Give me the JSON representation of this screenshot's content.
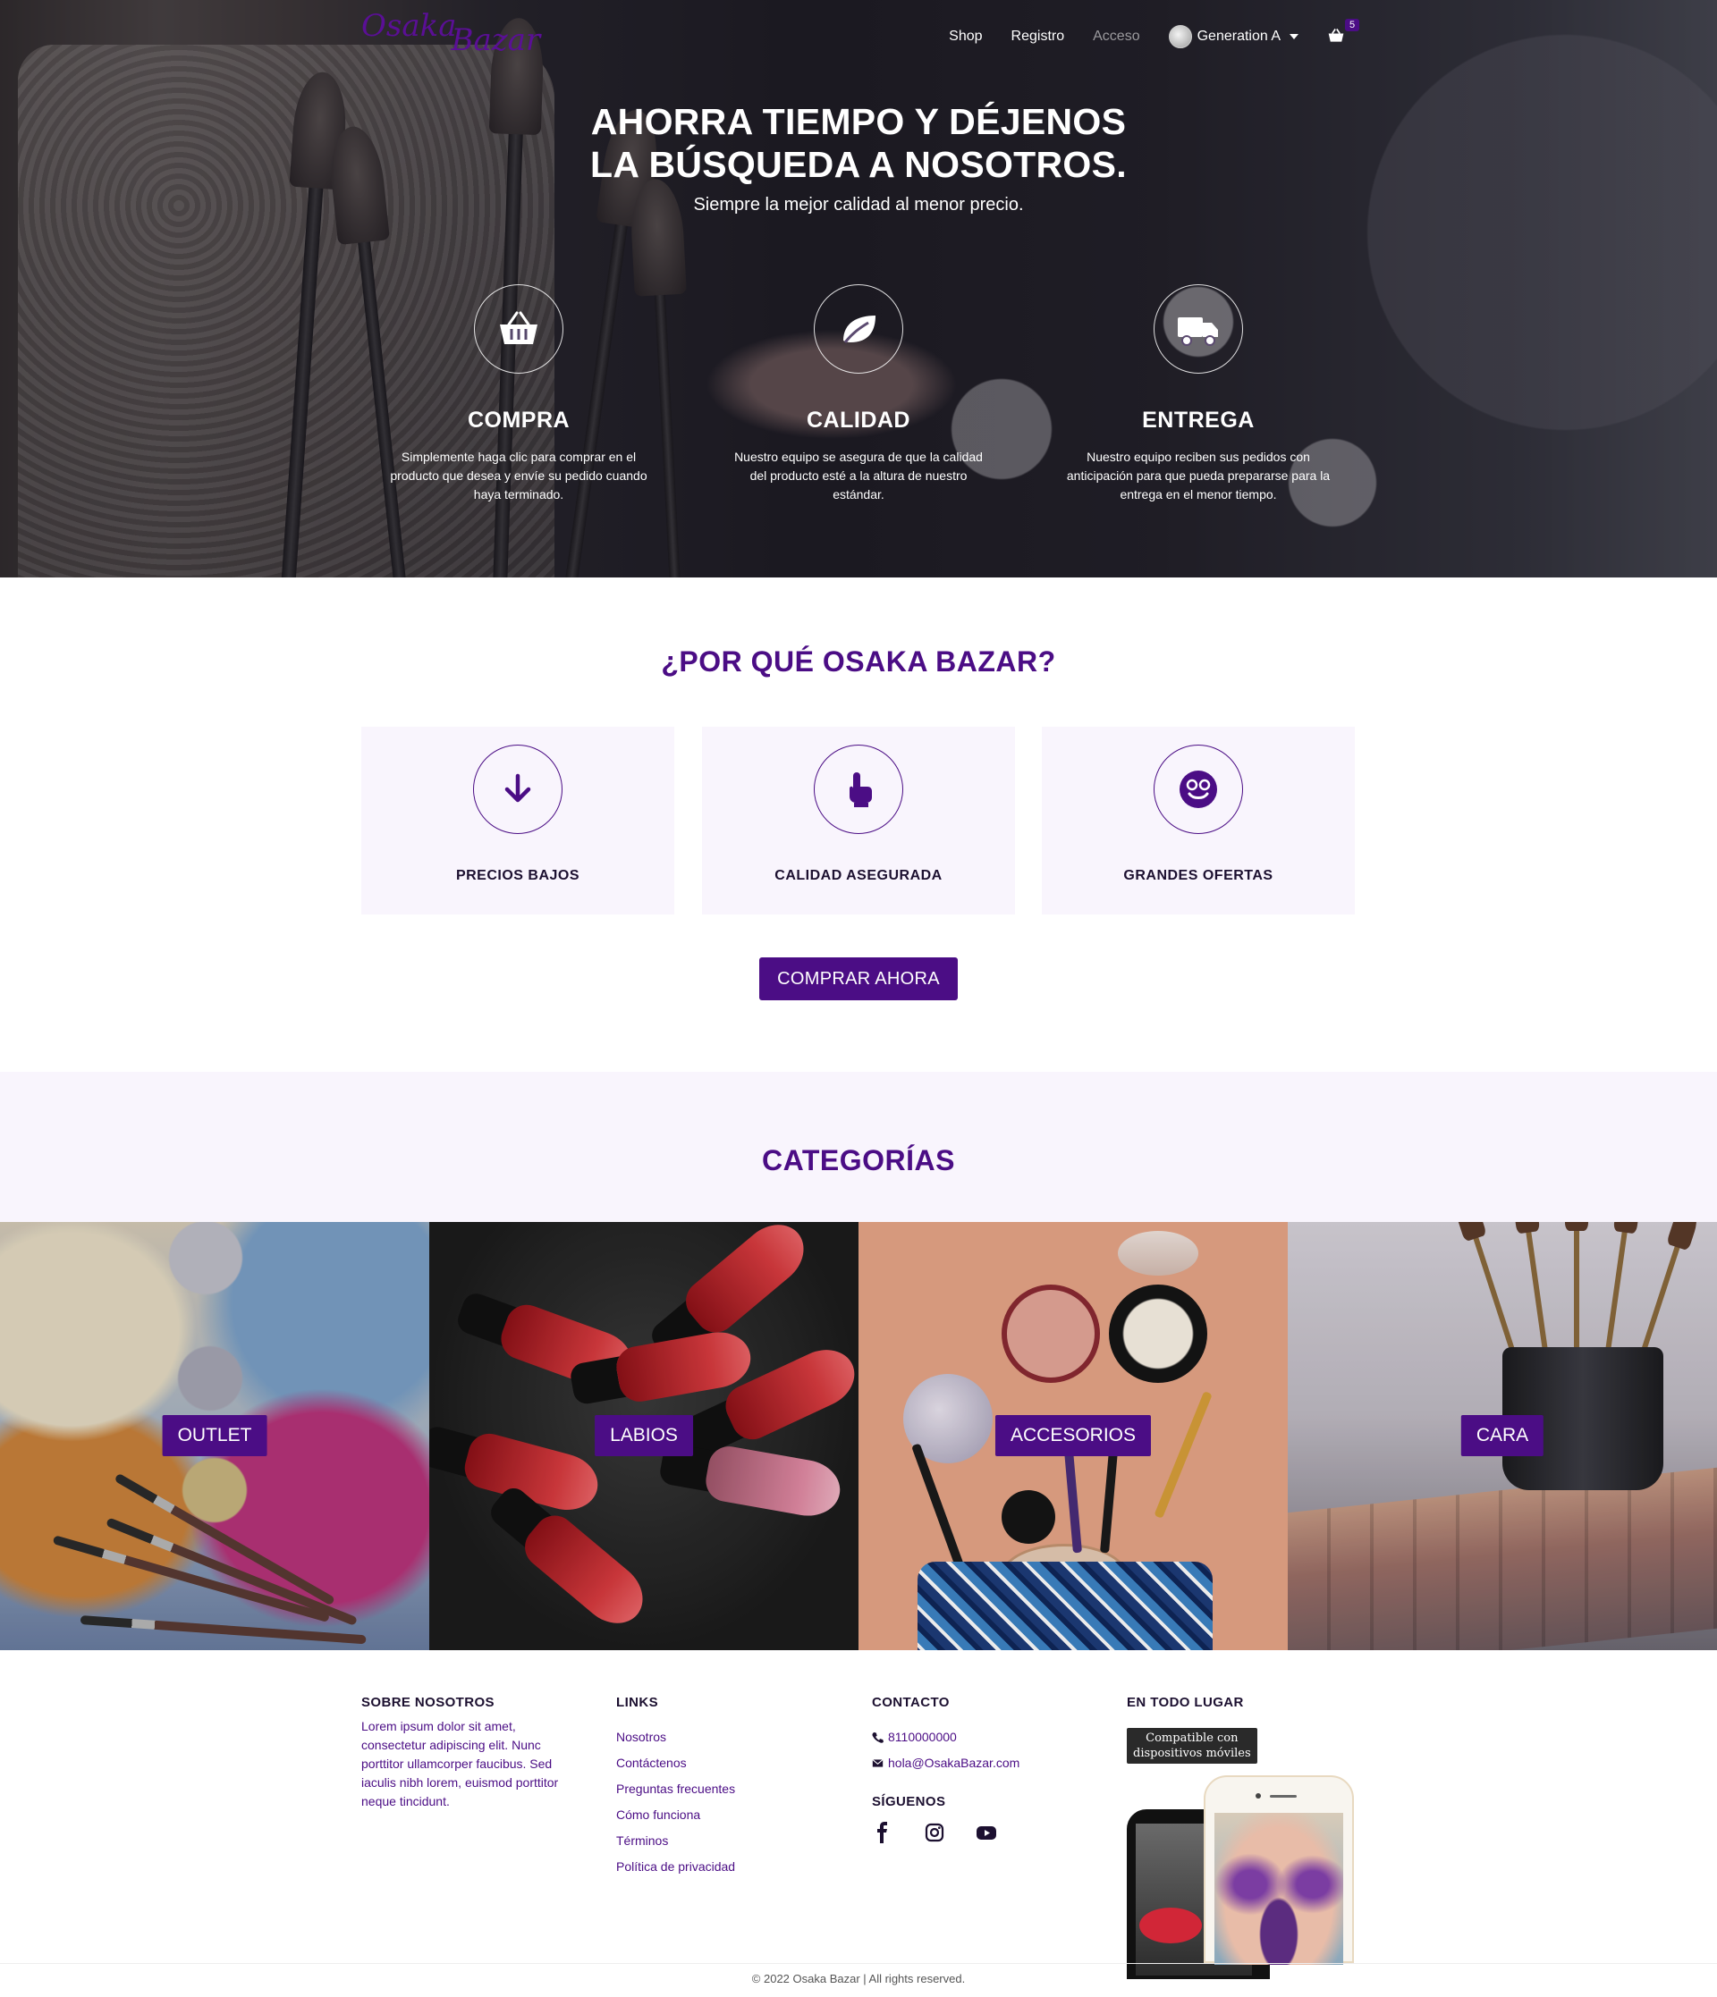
{
  "brand": {
    "name_line1": "Osaka",
    "name_line2": "Bazar",
    "accent": "#4b0d85"
  },
  "nav": {
    "shop": "Shop",
    "register": "Registro",
    "login": "Acceso",
    "user": "Generation A",
    "cart_count": "5"
  },
  "hero": {
    "title_line1": "AHORRA TIEMPO Y DÉJENOS",
    "title_line2": "LA BÚSQUEDA A NOSOTROS.",
    "subtitle": "Siempre la mejor calidad al menor precio.",
    "features": [
      {
        "icon": "basket-icon",
        "title": "COMPRA",
        "text": "Simplemente haga clic para comprar en el producto que desea y envíe su pedido cuando haya terminado."
      },
      {
        "icon": "leaf-icon",
        "title": "CALIDAD",
        "text": "Nuestro equipo se asegura de que la calidad del producto esté a la altura de nuestro estándar."
      },
      {
        "icon": "truck-icon",
        "title": "ENTREGA",
        "text": "Nuestro equipo reciben sus pedidos con anticipación para que pueda prepararse para la entrega en el menor tiempo."
      }
    ]
  },
  "why": {
    "title": "¿POR QUÉ OSAKA BAZAR?",
    "cards": [
      {
        "icon": "arrow-down-icon",
        "label": "PRECIOS BAJOS"
      },
      {
        "icon": "hand-pointer-icon",
        "label": "CALIDAD ASEGURADA"
      },
      {
        "icon": "smile-icon",
        "label": "GRANDES OFERTAS"
      }
    ],
    "cta": "COMPRAR AHORA"
  },
  "categories": {
    "title": "CATEGORÍAS",
    "items": [
      {
        "label": "OUTLET"
      },
      {
        "label": "LABIOS"
      },
      {
        "label": "ACCESORIOS"
      },
      {
        "label": "CARA"
      }
    ]
  },
  "footer": {
    "about_title": "SOBRE NOSOTROS",
    "about_text": "Lorem ipsum dolor sit amet, consectetur adipiscing elit. Nunc porttitor ullamcorper faucibus. Sed iaculis nibh lorem, euismod porttitor neque tincidunt.",
    "links_title": "LINKS",
    "links": [
      "Nosotros",
      "Contáctenos",
      "Preguntas frecuentes",
      "Cómo funciona",
      "Términos",
      "Política de privacidad"
    ],
    "contact_title": "CONTACTO",
    "phone": "8110000000",
    "email": "hola@OsakaBazar.com",
    "follow_title": "SÍGUENOS",
    "everywhere_title": "EN TODO LUGAR",
    "mobile_badge_line1": "Compatible con",
    "mobile_badge_line2": "dispositivos móviles",
    "copyright": "© 2022 Osaka Bazar | All rights reserved."
  }
}
